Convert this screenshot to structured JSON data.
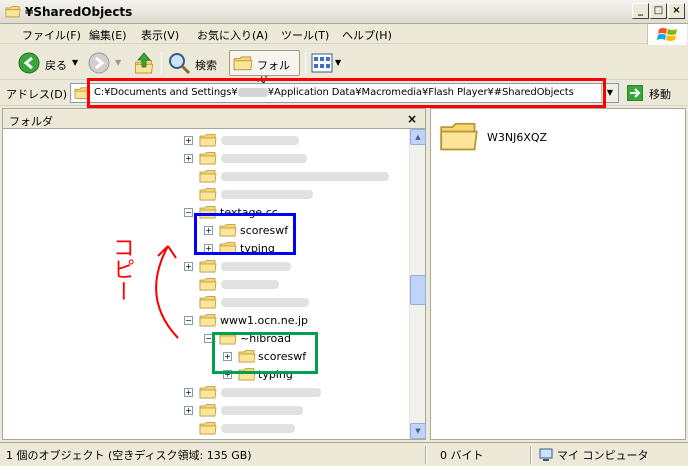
{
  "window": {
    "title": "¥SharedObjects"
  },
  "menu": {
    "file": "ファイル(F)",
    "edit": "編集(E)",
    "view": "表示(V)",
    "favorites": "お気に入り(A)",
    "tools": "ツール(T)",
    "help": "ヘルプ(H)"
  },
  "toolbar": {
    "back_label": "戻る",
    "search_label": "検索",
    "folders_label": "フォルダ"
  },
  "address": {
    "label": "アドレス(D)",
    "path_prefix": "C:¥Documents and Settings¥",
    "path_suffix": "¥Application Data¥Macromedia¥Flash Player¥#SharedObjects",
    "go_label": "移動"
  },
  "tree": {
    "header": "フォルダ",
    "nodes": {
      "textage": "textage.cc",
      "scoreswf_a": "scoreswf",
      "typing_a": "typing",
      "ocn": "www1.ocn.ne.jp",
      "hibroad": "~hibroad",
      "scoreswf_b": "scoreswf",
      "typing_b": "typing"
    }
  },
  "content": {
    "item": "W3NJ6XQZ"
  },
  "annotation": {
    "text": "コピー"
  },
  "status": {
    "objects": "1 個のオブジェクト (空きディスク領域: 135 GB)",
    "size": "0 バイト",
    "location": "マイ コンピュータ"
  },
  "colors": {
    "address_highlight": "#ff0000",
    "source_highlight": "#0000ff",
    "dest_highlight": "#00a050",
    "folder": "#f5d66f"
  }
}
